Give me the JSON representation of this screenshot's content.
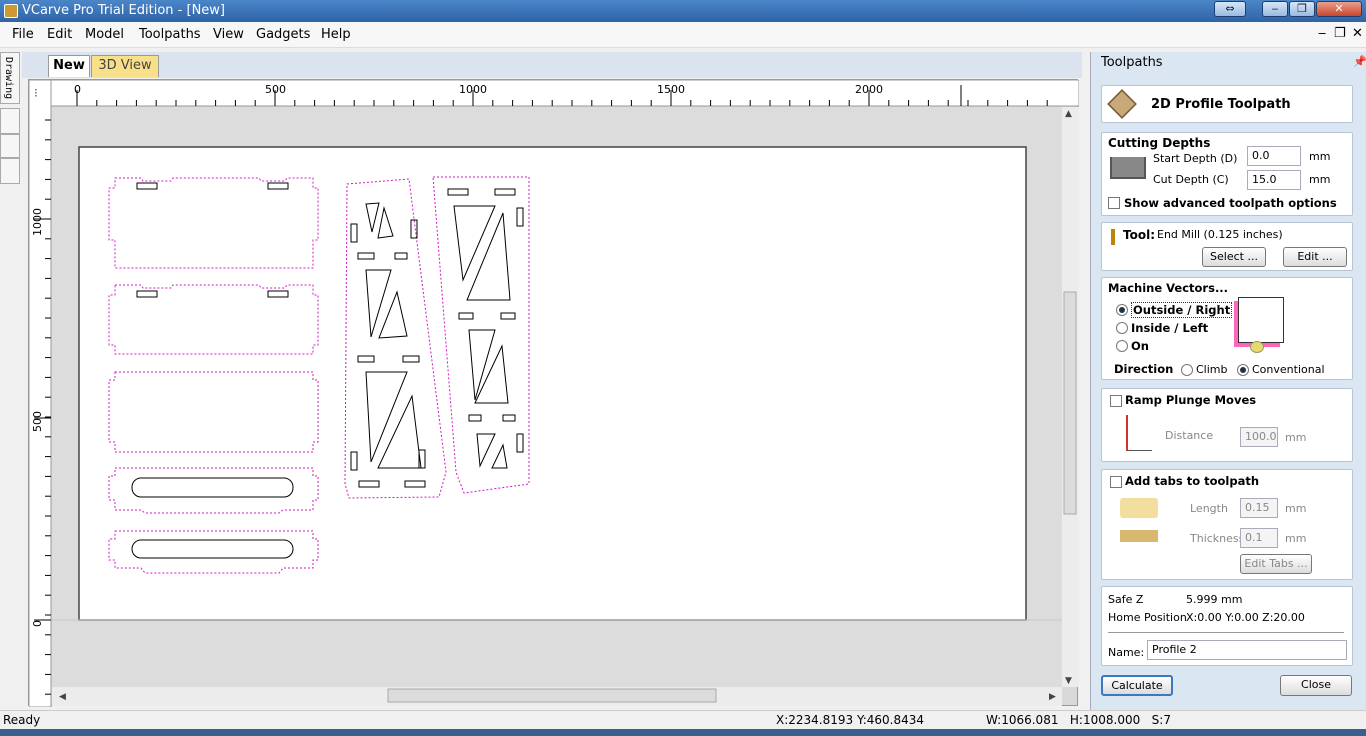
{
  "titlebar": {
    "title": "VCarve Pro Trial Edition - [New]"
  },
  "menu": [
    "File",
    "Edit",
    "Model",
    "Toolpaths",
    "View",
    "Gadgets",
    "Help"
  ],
  "side_tab": "Drawing",
  "tabs": [
    {
      "label": "New",
      "active": true
    },
    {
      "label": "3D View",
      "active": false
    }
  ],
  "ruler": {
    "top": [
      "0",
      "500",
      "1000",
      "1500",
      "2000"
    ],
    "left": [
      "1000",
      "500",
      "0"
    ]
  },
  "panel": {
    "header": "Toolpaths",
    "title": "2D Profile Toolpath",
    "cutting": {
      "heading": "Cutting Depths",
      "start_label": "Start Depth (D)",
      "start_value": "0.0",
      "cut_label": "Cut Depth (C)",
      "cut_value": "15.0",
      "unit": "mm",
      "advanced": "Show advanced toolpath options"
    },
    "tool": {
      "label": "Tool:",
      "value": "End Mill (0.125 inches)",
      "select": "Select ...",
      "edit": "Edit ..."
    },
    "machine": {
      "heading": "Machine Vectors...",
      "outside": "Outside / Right",
      "inside": "Inside / Left",
      "on": "On",
      "direction": "Direction",
      "climb": "Climb",
      "conventional": "Conventional"
    },
    "ramp": {
      "label": "Ramp Plunge Moves",
      "distance_label": "Distance",
      "distance_value": "100.0",
      "unit": "mm"
    },
    "tabs": {
      "label": "Add tabs to toolpath",
      "length_label": "Length",
      "length_value": "0.15",
      "thickness_label": "Thickness",
      "thickness_value": "0.1",
      "unit": "mm",
      "edit": "Edit Tabs ..."
    },
    "safe": {
      "safez_label": "Safe Z",
      "safez_value": "5.999 mm",
      "home_label": "Home Position",
      "home_value": "X:0.00 Y:0.00 Z:20.00",
      "name_label": "Name:",
      "name_value": "Profile 2"
    },
    "calculate": "Calculate",
    "close": "Close"
  },
  "status": {
    "left": "Ready",
    "coords": "X:2234.8193 Y:460.8434",
    "size": "W:1066.081   H:1008.000   S:7"
  }
}
